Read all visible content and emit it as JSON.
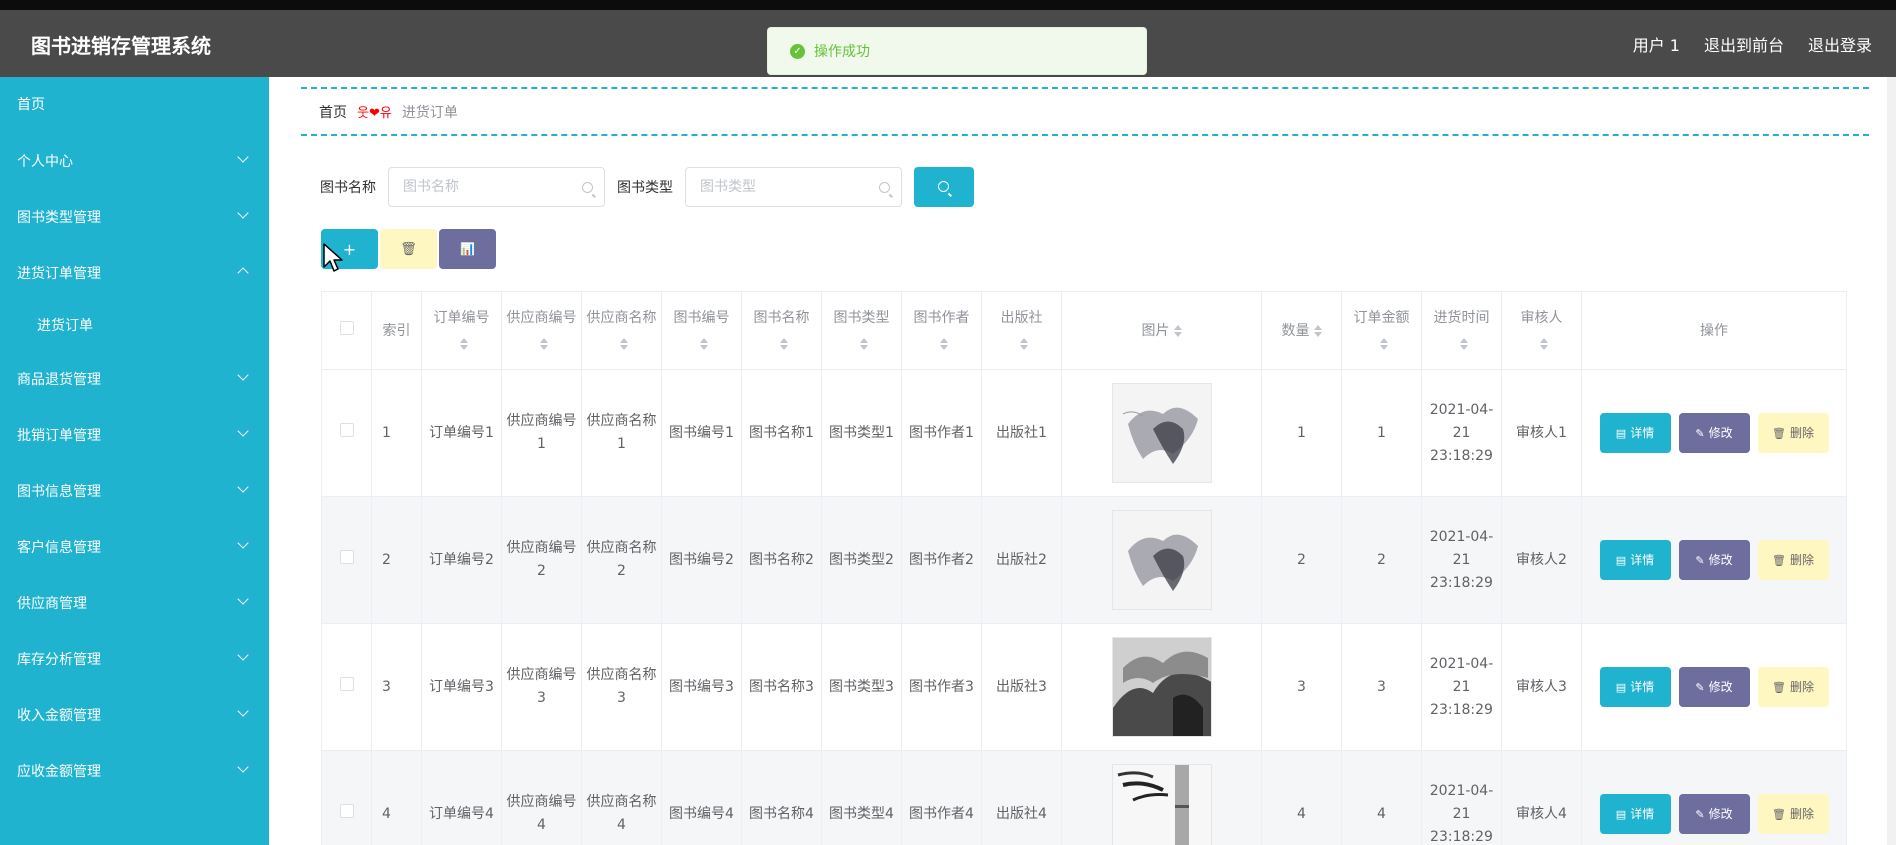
{
  "header": {
    "app_title": "图书进销存管理系统",
    "user": "用户 1",
    "exit_front": "退出到前台",
    "logout": "退出登录"
  },
  "toast": {
    "message": "操作成功"
  },
  "sidebar": {
    "items": [
      {
        "label": "首页",
        "expandable": false
      },
      {
        "label": "个人中心",
        "expandable": true,
        "expanded": false
      },
      {
        "label": "图书类型管理",
        "expandable": true,
        "expanded": false
      },
      {
        "label": "进货订单管理",
        "expandable": true,
        "expanded": true
      },
      {
        "label": "进货订单",
        "sub": true
      },
      {
        "label": "商品退货管理",
        "expandable": true,
        "expanded": false
      },
      {
        "label": "批销订单管理",
        "expandable": true,
        "expanded": false
      },
      {
        "label": "图书信息管理",
        "expandable": true,
        "expanded": false
      },
      {
        "label": "客户信息管理",
        "expandable": true,
        "expanded": false
      },
      {
        "label": "供应商管理",
        "expandable": true,
        "expanded": false
      },
      {
        "label": "库存分析管理",
        "expandable": true,
        "expanded": false
      },
      {
        "label": "收入金额管理",
        "expandable": true,
        "expanded": false
      },
      {
        "label": "应收金额管理",
        "expandable": true,
        "expanded": false
      }
    ]
  },
  "breadcrumb": {
    "home": "首页",
    "separator": "웃❤유",
    "current": "进货订单"
  },
  "search": {
    "book_name_label": "图书名称",
    "book_name_placeholder": "图书名称",
    "book_type_label": "图书类型",
    "book_type_placeholder": "图书类型"
  },
  "actions": {
    "add": "+",
    "delete": "🗑",
    "chart": "📊"
  },
  "table": {
    "columns": [
      "索引",
      "订单编号",
      "供应商编号",
      "供应商名称",
      "图书编号",
      "图书名称",
      "图书类型",
      "图书作者",
      "出版社",
      "图片",
      "数量",
      "订单金额",
      "进货时间",
      "审核人",
      "操作"
    ],
    "rows": [
      {
        "index": "1",
        "order_no": "订单编号1",
        "supplier_no": "供应商编号1",
        "supplier_name": "供应商名称1",
        "book_no": "图书编号1",
        "book_name": "图书名称1",
        "book_type": "图书类型1",
        "author": "图书作者1",
        "publisher": "出版社1",
        "qty": "1",
        "amount": "1",
        "time": "2021-04-21 23:18:29",
        "reviewer": "审核人1"
      },
      {
        "index": "2",
        "order_no": "订单编号2",
        "supplier_no": "供应商编号2",
        "supplier_name": "供应商名称2",
        "book_no": "图书编号2",
        "book_name": "图书名称2",
        "book_type": "图书类型2",
        "author": "图书作者2",
        "publisher": "出版社2",
        "qty": "2",
        "amount": "2",
        "time": "2021-04-21 23:18:29",
        "reviewer": "审核人2"
      },
      {
        "index": "3",
        "order_no": "订单编号3",
        "supplier_no": "供应商编号3",
        "supplier_name": "供应商名称3",
        "book_no": "图书编号3",
        "book_name": "图书名称3",
        "book_type": "图书类型3",
        "author": "图书作者3",
        "publisher": "出版社3",
        "qty": "3",
        "amount": "3",
        "time": "2021-04-21 23:18:29",
        "reviewer": "审核人3"
      },
      {
        "index": "4",
        "order_no": "订单编号4",
        "supplier_no": "供应商编号4",
        "supplier_name": "供应商名称4",
        "book_no": "图书编号4",
        "book_name": "图书名称4",
        "book_type": "图书类型4",
        "author": "图书作者4",
        "publisher": "出版社4",
        "qty": "4",
        "amount": "4",
        "time": "2021-04-21 23:18:29",
        "reviewer": "审核人4"
      }
    ],
    "op_labels": {
      "detail": "详情",
      "edit": "修改",
      "remove": "删除"
    }
  },
  "colors": {
    "sidebar": "#1fb3cf",
    "header": "#4a4a4a",
    "primary": "#1fb3cf",
    "secondary": "#6d6e9e",
    "warning": "#fff7c2",
    "success": "#67c23a"
  }
}
